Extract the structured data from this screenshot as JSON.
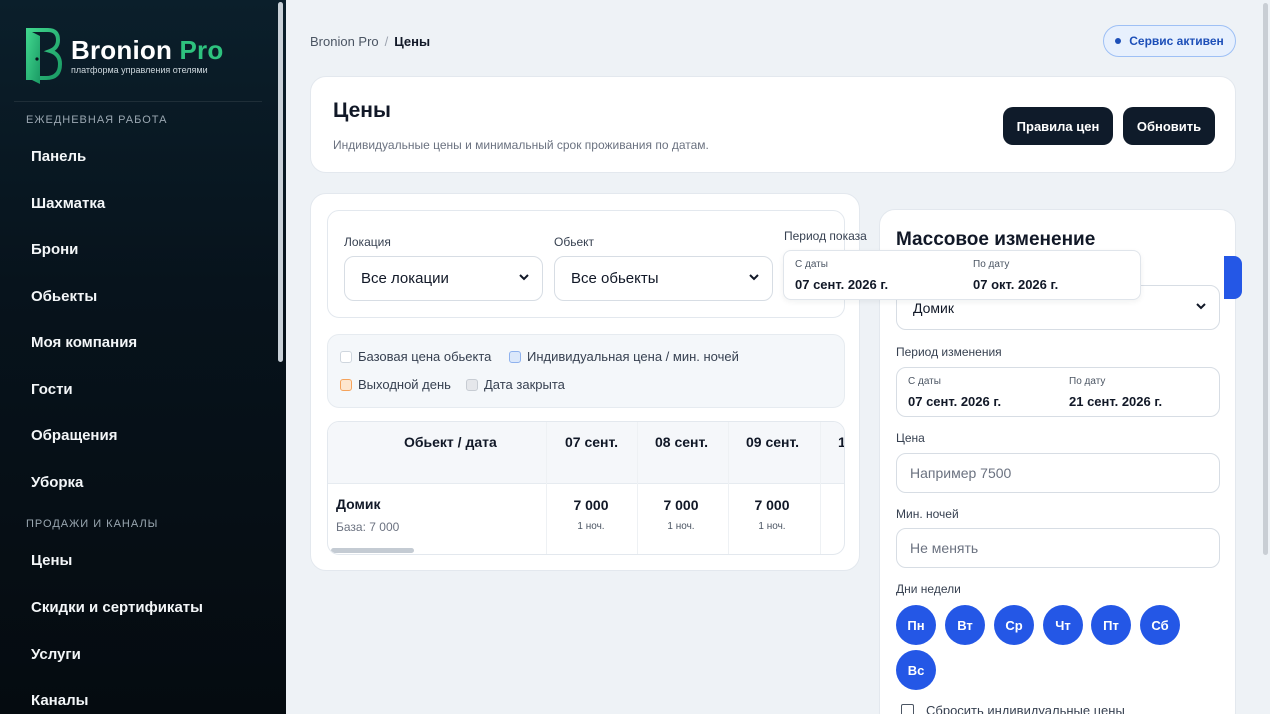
{
  "sidebar": {
    "logo": {
      "brand": "Bronion",
      "brand_accent": "Pro",
      "subtitle": "платформа управления отелями"
    },
    "sections": [
      "ЕЖЕДНЕВНАЯ РАБОТА",
      "ПРОДАЖИ И КАНАЛЫ"
    ],
    "items": [
      "Панель",
      "Шахматка",
      "Брони",
      "Обьекты",
      "Моя компания",
      "Гости",
      "Обращения",
      "Уборка",
      "Цены",
      "Скидки и сертификаты",
      "Услуги",
      "Каналы"
    ]
  },
  "breadcrumb": {
    "root": "Bronion Pro",
    "separator": "/",
    "current": "Цены"
  },
  "status_badge": "Сервис активен",
  "header": {
    "title": "Цены",
    "description": "Индивидуальные цены и минимальный срок проживания по датам.",
    "rules_button": "Правила цен",
    "refresh_button": "Обновить"
  },
  "filters": {
    "location_label": "Локация",
    "location_value": "Все локации",
    "object_label": "Обьект",
    "object_value": "Все обьекты",
    "period_label": "Период показа",
    "from_label": "С даты",
    "from_value": "07 сент. 2026 г.",
    "to_label": "По дату",
    "to_value": "07 окт. 2026 г."
  },
  "legend": [
    "Базовая цена обьекта",
    "Индивидуальная цена / мин. ночей",
    "Выходной день",
    "Дата закрыта"
  ],
  "table": {
    "header": "Обьект / дата",
    "dates": [
      "07 сент.",
      "08 сент.",
      "09 сент.",
      "1"
    ],
    "rows": [
      {
        "name": "Домик",
        "base": "База: 7 000",
        "cells": [
          {
            "price": "7 000",
            "nights": "1 ноч."
          },
          {
            "price": "7 000",
            "nights": "1 ноч."
          },
          {
            "price": "7 000",
            "nights": "1 ноч."
          }
        ]
      }
    ]
  },
  "bulk": {
    "title": "Массовое изменение",
    "object_value": "Домик",
    "period_label": "Период изменения",
    "from_label": "С даты",
    "from_value": "07 сент. 2026 г.",
    "to_label": "По дату",
    "to_value": "21 сент. 2026 г.",
    "price_label": "Цена",
    "price_placeholder": "Например 7500",
    "min_nights_label": "Мин. ночей",
    "min_nights_placeholder": "Не менять",
    "weekdays_label": "Дни недели",
    "weekdays": [
      "Пн",
      "Вт",
      "Ср",
      "Чт",
      "Пт",
      "Сб",
      "Вс"
    ],
    "reset_label": "Сбросить индивидуальные цены"
  },
  "colors": {
    "accent": "#2457e6",
    "brand_green": "#2ec27e",
    "dark_button": "#0f1b2a",
    "weekend": "#f5a35c"
  }
}
